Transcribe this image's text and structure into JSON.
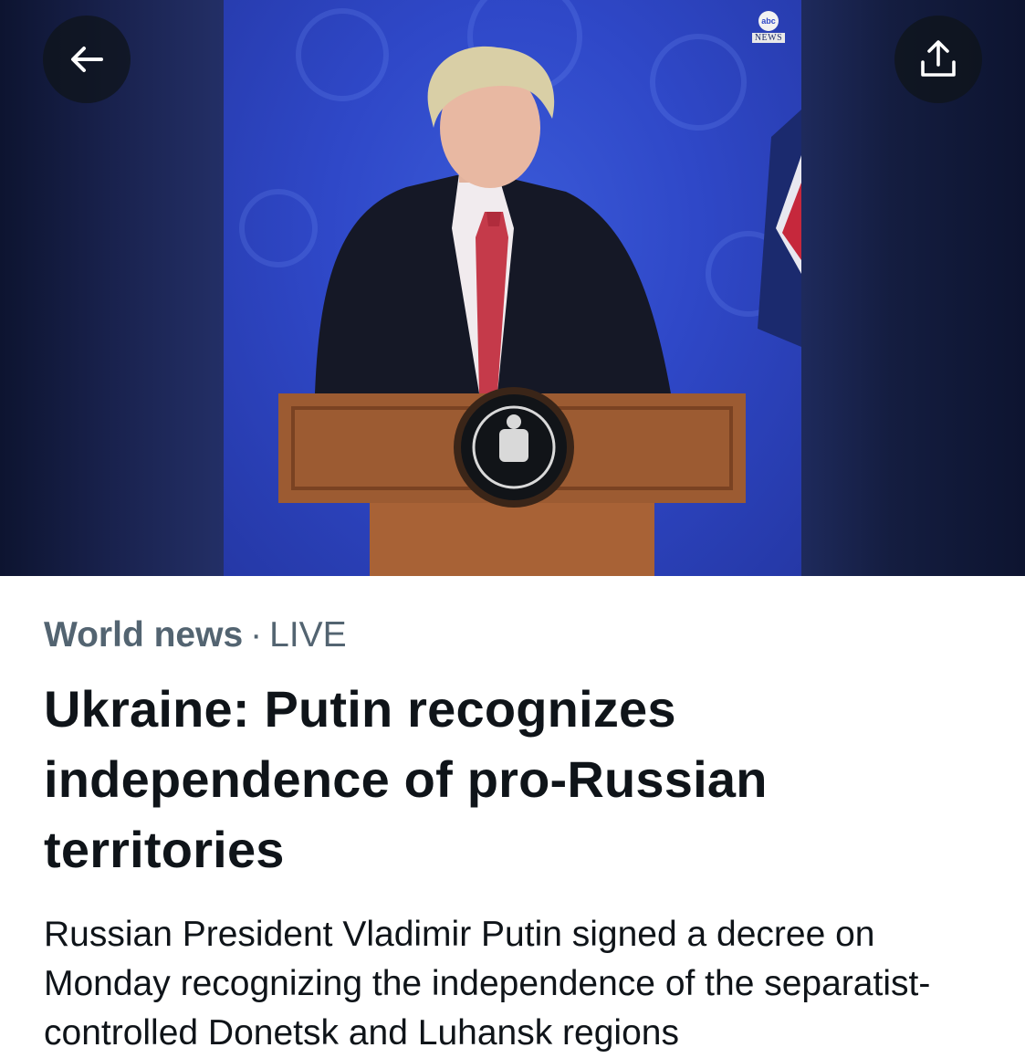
{
  "media": {
    "channel_bug": "abc",
    "channel_name": "NEWS",
    "back_icon": "arrow-left-icon",
    "share_icon": "share-upload-icon"
  },
  "article": {
    "category": "World news",
    "separator": "·",
    "status": "LIVE",
    "headline": "Ukraine: Putin recognizes independence of pro-Russian territories",
    "summary": "Russian President Vladimir Putin signed a decree on Monday recognizing the independence of the separatist-controlled Donetsk and Luhansk regions"
  },
  "colors": {
    "meta_text": "#536471",
    "body_text": "#0f1419",
    "overlay_button": "#0f1419"
  }
}
